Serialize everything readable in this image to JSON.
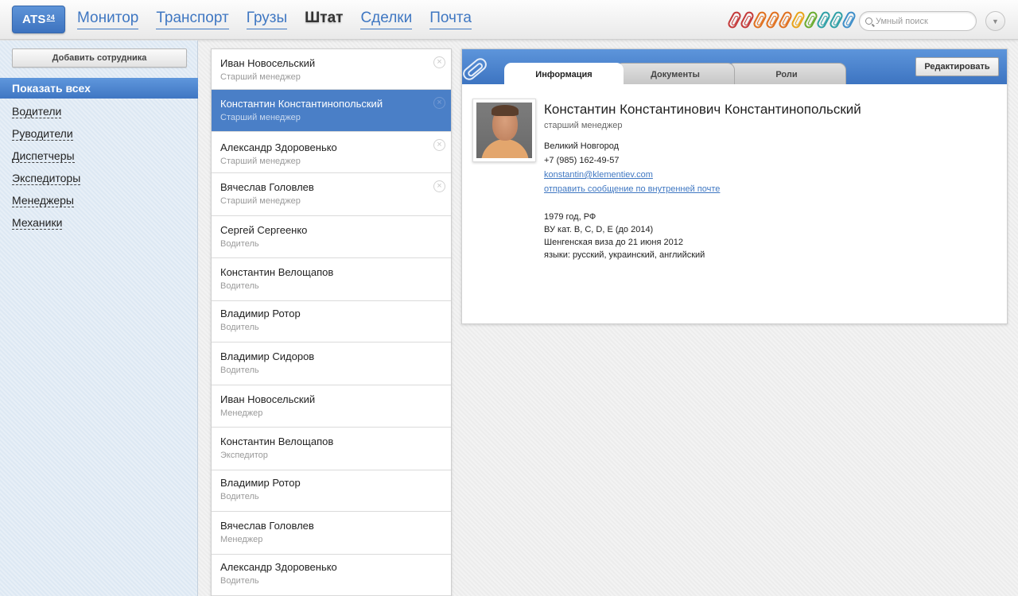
{
  "header": {
    "logo_text": "ATS",
    "logo_sup": "24",
    "nav": [
      {
        "label": "Монитор",
        "active": false
      },
      {
        "label": "Транспорт",
        "active": false
      },
      {
        "label": "Грузы",
        "active": false
      },
      {
        "label": "Штат",
        "active": true
      },
      {
        "label": "Сделки",
        "active": false
      },
      {
        "label": "Почта",
        "active": false
      }
    ],
    "clip_colors": [
      "#c43a3a",
      "#c43a3a",
      "#e0701f",
      "#e0701f",
      "#e0701f",
      "#e8a41a",
      "#6aab2e",
      "#2fa0a6",
      "#2fa0a6",
      "#3f8fc9"
    ],
    "search": {
      "placeholder": "Умный поиск"
    },
    "menu_icon": "▼"
  },
  "sidebar": {
    "add_button": "Добавить сотрудника",
    "show_all": "Показать всех",
    "categories": [
      "Водители",
      "Руводители",
      "Диспетчеры",
      "Экспедиторы",
      "Менеджеры",
      "Механики"
    ]
  },
  "employees": [
    {
      "name": "Иван Новосельский",
      "role": "Старший менеджер",
      "removable": true,
      "selected": false
    },
    {
      "name": "Константин Константинопольский",
      "role": "Старший менеджер",
      "removable": true,
      "selected": true
    },
    {
      "name": "Александр Здоровенько",
      "role": "Старший менеджер",
      "removable": true,
      "selected": false
    },
    {
      "name": "Вячеслав Головлев",
      "role": "Старший менеджер",
      "removable": true,
      "selected": false
    },
    {
      "name": "Сергей Сергеенко",
      "role": "Водитель",
      "removable": false,
      "selected": false
    },
    {
      "name": "Константин Велощапов",
      "role": "Водитель",
      "removable": false,
      "selected": false
    },
    {
      "name": "Владимир Ротор",
      "role": "Водитель",
      "removable": false,
      "selected": false
    },
    {
      "name": "Владимир Сидоров",
      "role": "Водитель",
      "removable": false,
      "selected": false
    },
    {
      "name": "Иван Новосельский",
      "role": "Менеджер",
      "removable": false,
      "selected": false
    },
    {
      "name": "Константин Велощапов",
      "role": "Экспедитор",
      "removable": false,
      "selected": false
    },
    {
      "name": "Владимир Ротор",
      "role": "Водитель",
      "removable": false,
      "selected": false
    },
    {
      "name": "Вячеслав Головлев",
      "role": "Менеджер",
      "removable": false,
      "selected": false
    },
    {
      "name": "Александр Здоровенько",
      "role": "Водитель",
      "removable": false,
      "selected": false
    }
  ],
  "detail": {
    "tabs": [
      "Информация",
      "Документы",
      "Роли"
    ],
    "active_tab": 0,
    "edit_button": "Редактировать",
    "full_name": "Константин Константинович Константинопольский",
    "position": "старший менеджер",
    "city": "Великий Новгород",
    "phone": "+7 (985) 162-49-57",
    "email": "konstantin@klementiev.com",
    "message_link": "отправить сообщение по внутренней почте",
    "extra": [
      "1979 год, РФ",
      "ВУ кат. B, C, D, E (до 2014)",
      "Шенгенская виза до 21 июня 2012",
      "языки: русский, украинский, английский"
    ]
  }
}
